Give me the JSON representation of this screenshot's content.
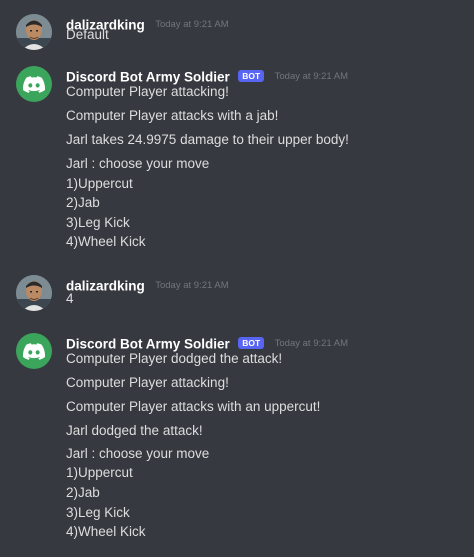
{
  "messages": [
    {
      "author": "dalizardking",
      "is_bot": false,
      "timestamp": "Today at 9:21 AM",
      "lines": [
        "Default"
      ]
    },
    {
      "author": "Discord Bot Army Soldier",
      "is_bot": true,
      "bot_tag": "BOT",
      "timestamp": "Today at 9:21 AM",
      "lines": [
        "Computer Player attacking!",
        "Computer Player attacks with a jab!",
        "Jarl takes 24.9975 damage to their upper body!",
        "Jarl : choose your move",
        "1)Uppercut",
        "2)Jab",
        "3)Leg Kick",
        "4)Wheel Kick"
      ]
    },
    {
      "author": "dalizardking",
      "is_bot": false,
      "timestamp": "Today at 9:21 AM",
      "lines": [
        "4"
      ]
    },
    {
      "author": "Discord Bot Army Soldier",
      "is_bot": true,
      "bot_tag": "BOT",
      "timestamp": "Today at 9:21 AM",
      "lines": [
        "Computer Player dodged the attack!",
        "Computer Player attacking!",
        "Computer Player attacks with an uppercut!",
        "Jarl dodged the attack!",
        "Jarl : choose your move",
        "1)Uppercut",
        "2)Jab",
        "3)Leg Kick",
        "4)Wheel Kick"
      ]
    }
  ],
  "colors": {
    "background": "#36393f",
    "username": "#ffffff",
    "text": "#dcddde",
    "timestamp": "#72767d",
    "bot_tag": "#5865f2",
    "discord_avatar": "#3ba55c"
  },
  "icons": {
    "bot_avatar": "discord-logo-icon",
    "user_avatar": "user-avatar"
  }
}
